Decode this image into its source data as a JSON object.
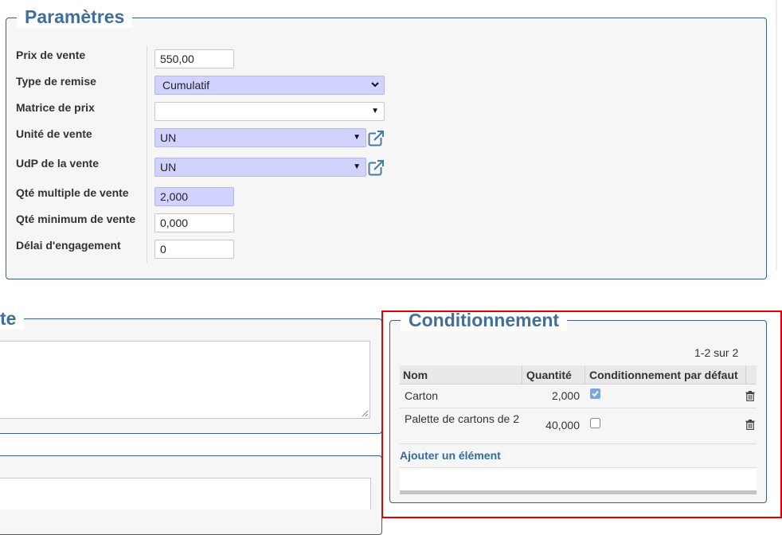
{
  "params": {
    "title": "Paramètres",
    "fields": {
      "sale_price": {
        "label": "Prix de vente",
        "value": "550,00"
      },
      "discount_type": {
        "label": "Type de remise",
        "value": "Cumulatif"
      },
      "price_matrix": {
        "label": "Matrice de prix",
        "value": ""
      },
      "sale_unit": {
        "label": "Unité de vente",
        "value": "UN"
      },
      "udp_sale": {
        "label": "UdP de la vente",
        "value": "UN"
      },
      "multiple_qty": {
        "label": "Qté multiple de vente",
        "value": "2,000"
      },
      "min_qty": {
        "label": "Qté minimum de vente",
        "value": "0,000"
      },
      "commitment_delay": {
        "label": "Délai d'engagement",
        "value": "0"
      }
    }
  },
  "left_section": {
    "title_fragment": "te"
  },
  "packaging": {
    "title": "Conditionnement",
    "pager": "1-2 sur 2",
    "columns": {
      "name": "Nom",
      "quantity": "Quantité",
      "default": "Conditionnement par défaut"
    },
    "rows": [
      {
        "name": "Carton",
        "quantity": "2,000",
        "default": true
      },
      {
        "name": "Palette de cartons de 2",
        "quantity": "40,000",
        "default": false
      }
    ],
    "add_item": "Ajouter un élément"
  },
  "colors": {
    "accent": "#3f6f9a",
    "required_bg": "#d2d2ff",
    "highlight": "#e00000"
  },
  "icons": [
    "external-link-icon",
    "trash-icon",
    "checkbox-checked-icon",
    "checkbox-empty-icon",
    "dropdown-arrow-icon"
  ]
}
